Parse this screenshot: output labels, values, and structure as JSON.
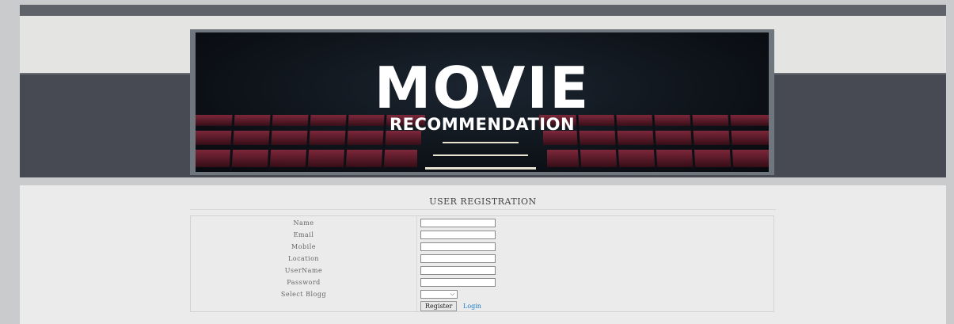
{
  "banner": {
    "title": "MOVIE",
    "subtitle": "RECOMMENDATION"
  },
  "form": {
    "heading": "USER REGISTRATION",
    "fields": [
      {
        "label": "Name",
        "value": ""
      },
      {
        "label": "Email",
        "value": ""
      },
      {
        "label": "Mobile",
        "value": ""
      },
      {
        "label": "Location",
        "value": ""
      },
      {
        "label": "UserName",
        "value": ""
      },
      {
        "label": "Password",
        "value": ""
      }
    ],
    "select_label": "Select Blogg",
    "select_value": "",
    "register_label": "Register",
    "login_label": "Login"
  },
  "colors": {
    "link": "#1e7ec8",
    "seat": "#7a1f33"
  },
  "icons": {
    "dropdown": "chevron-down-icon"
  }
}
